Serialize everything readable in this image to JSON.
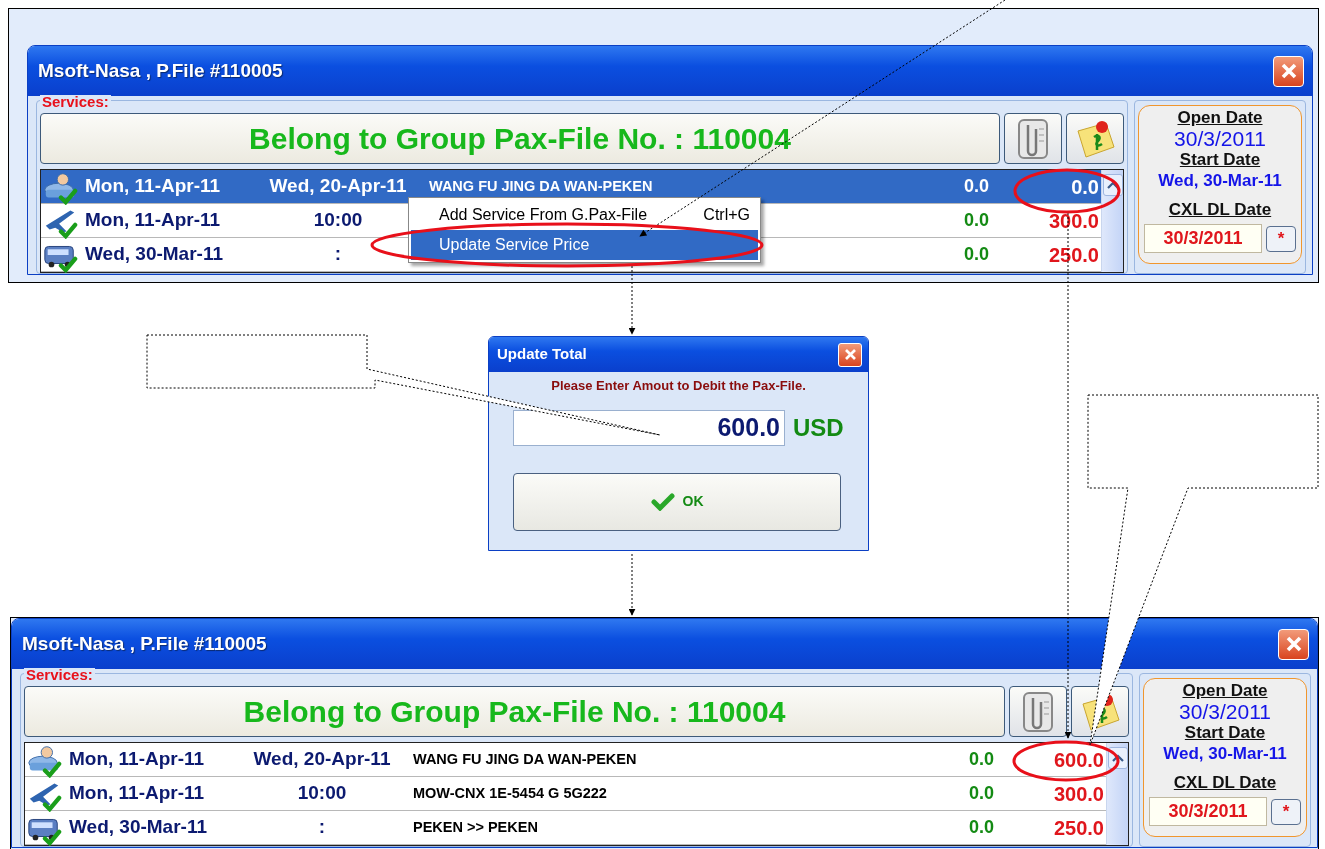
{
  "panels": [
    {
      "window_title": "Msoft-Nasa , P.File #110005",
      "services_label": "Services:",
      "group_banner": "Belong to Group Pax-File No. : 110004",
      "rows": [
        {
          "kind": "hotel",
          "selected": true,
          "date": "Mon, 11-Apr-11",
          "second": "Wed, 20-Apr-11",
          "description": "WANG FU JING DA WAN-PEKEN",
          "cost": "0.0",
          "price": "0.0"
        },
        {
          "kind": "flight",
          "selected": false,
          "date": "Mon, 11-Apr-11",
          "second": "10:00",
          "cost": "0.0",
          "price": "300.0"
        },
        {
          "kind": "bus",
          "selected": false,
          "date": "Wed, 30-Mar-11",
          "second": ":",
          "cost": "0.0",
          "price": "250.0"
        }
      ],
      "side": {
        "open_date_label": "Open Date",
        "open_date": "30/3/2011",
        "start_date_label": "Start Date",
        "start_date": "Wed, 30-Mar-11",
        "cxl_label": "CXL DL Date",
        "cxl_date": "30/3/2011",
        "cxl_button": "*"
      },
      "context_menu": {
        "items": [
          {
            "label": "Add Service From G.Pax-File",
            "shortcut": "Ctrl+G",
            "selected": false
          },
          {
            "label": "Update Service Price",
            "selected": true
          }
        ]
      }
    },
    {
      "window_title": "Msoft-Nasa , P.File #110005",
      "services_label": "Services:",
      "group_banner": "Belong to Group Pax-File No. : 110004",
      "rows": [
        {
          "kind": "hotel",
          "selected": false,
          "date": "Mon, 11-Apr-11",
          "second": "Wed, 20-Apr-11",
          "description": "WANG FU JING DA WAN-PEKEN",
          "cost": "0.0",
          "price": "600.0"
        },
        {
          "kind": "flight",
          "selected": false,
          "date": "Mon, 11-Apr-11",
          "second": "10:00",
          "description": "MOW-CNX  1E-5454  G  5G222",
          "cost": "0.0",
          "price": "300.0"
        },
        {
          "kind": "bus",
          "selected": false,
          "date": "Wed, 30-Mar-11",
          "second": ":",
          "description": "PEKEN >> PEKEN",
          "cost": "0.0",
          "price": "250.0"
        }
      ],
      "side": {
        "open_date_label": "Open Date",
        "open_date": "30/3/2011",
        "start_date_label": "Start Date",
        "start_date": "Wed, 30-Mar-11",
        "cxl_label": "CXL DL Date",
        "cxl_date": "30/3/2011",
        "cxl_button": "*"
      }
    }
  ],
  "dialog": {
    "title": "Update Total",
    "message": "Please Enter Amout to Debit the Pax-File.",
    "amount": "600.0",
    "currency": "USD",
    "ok_label": "OK"
  }
}
